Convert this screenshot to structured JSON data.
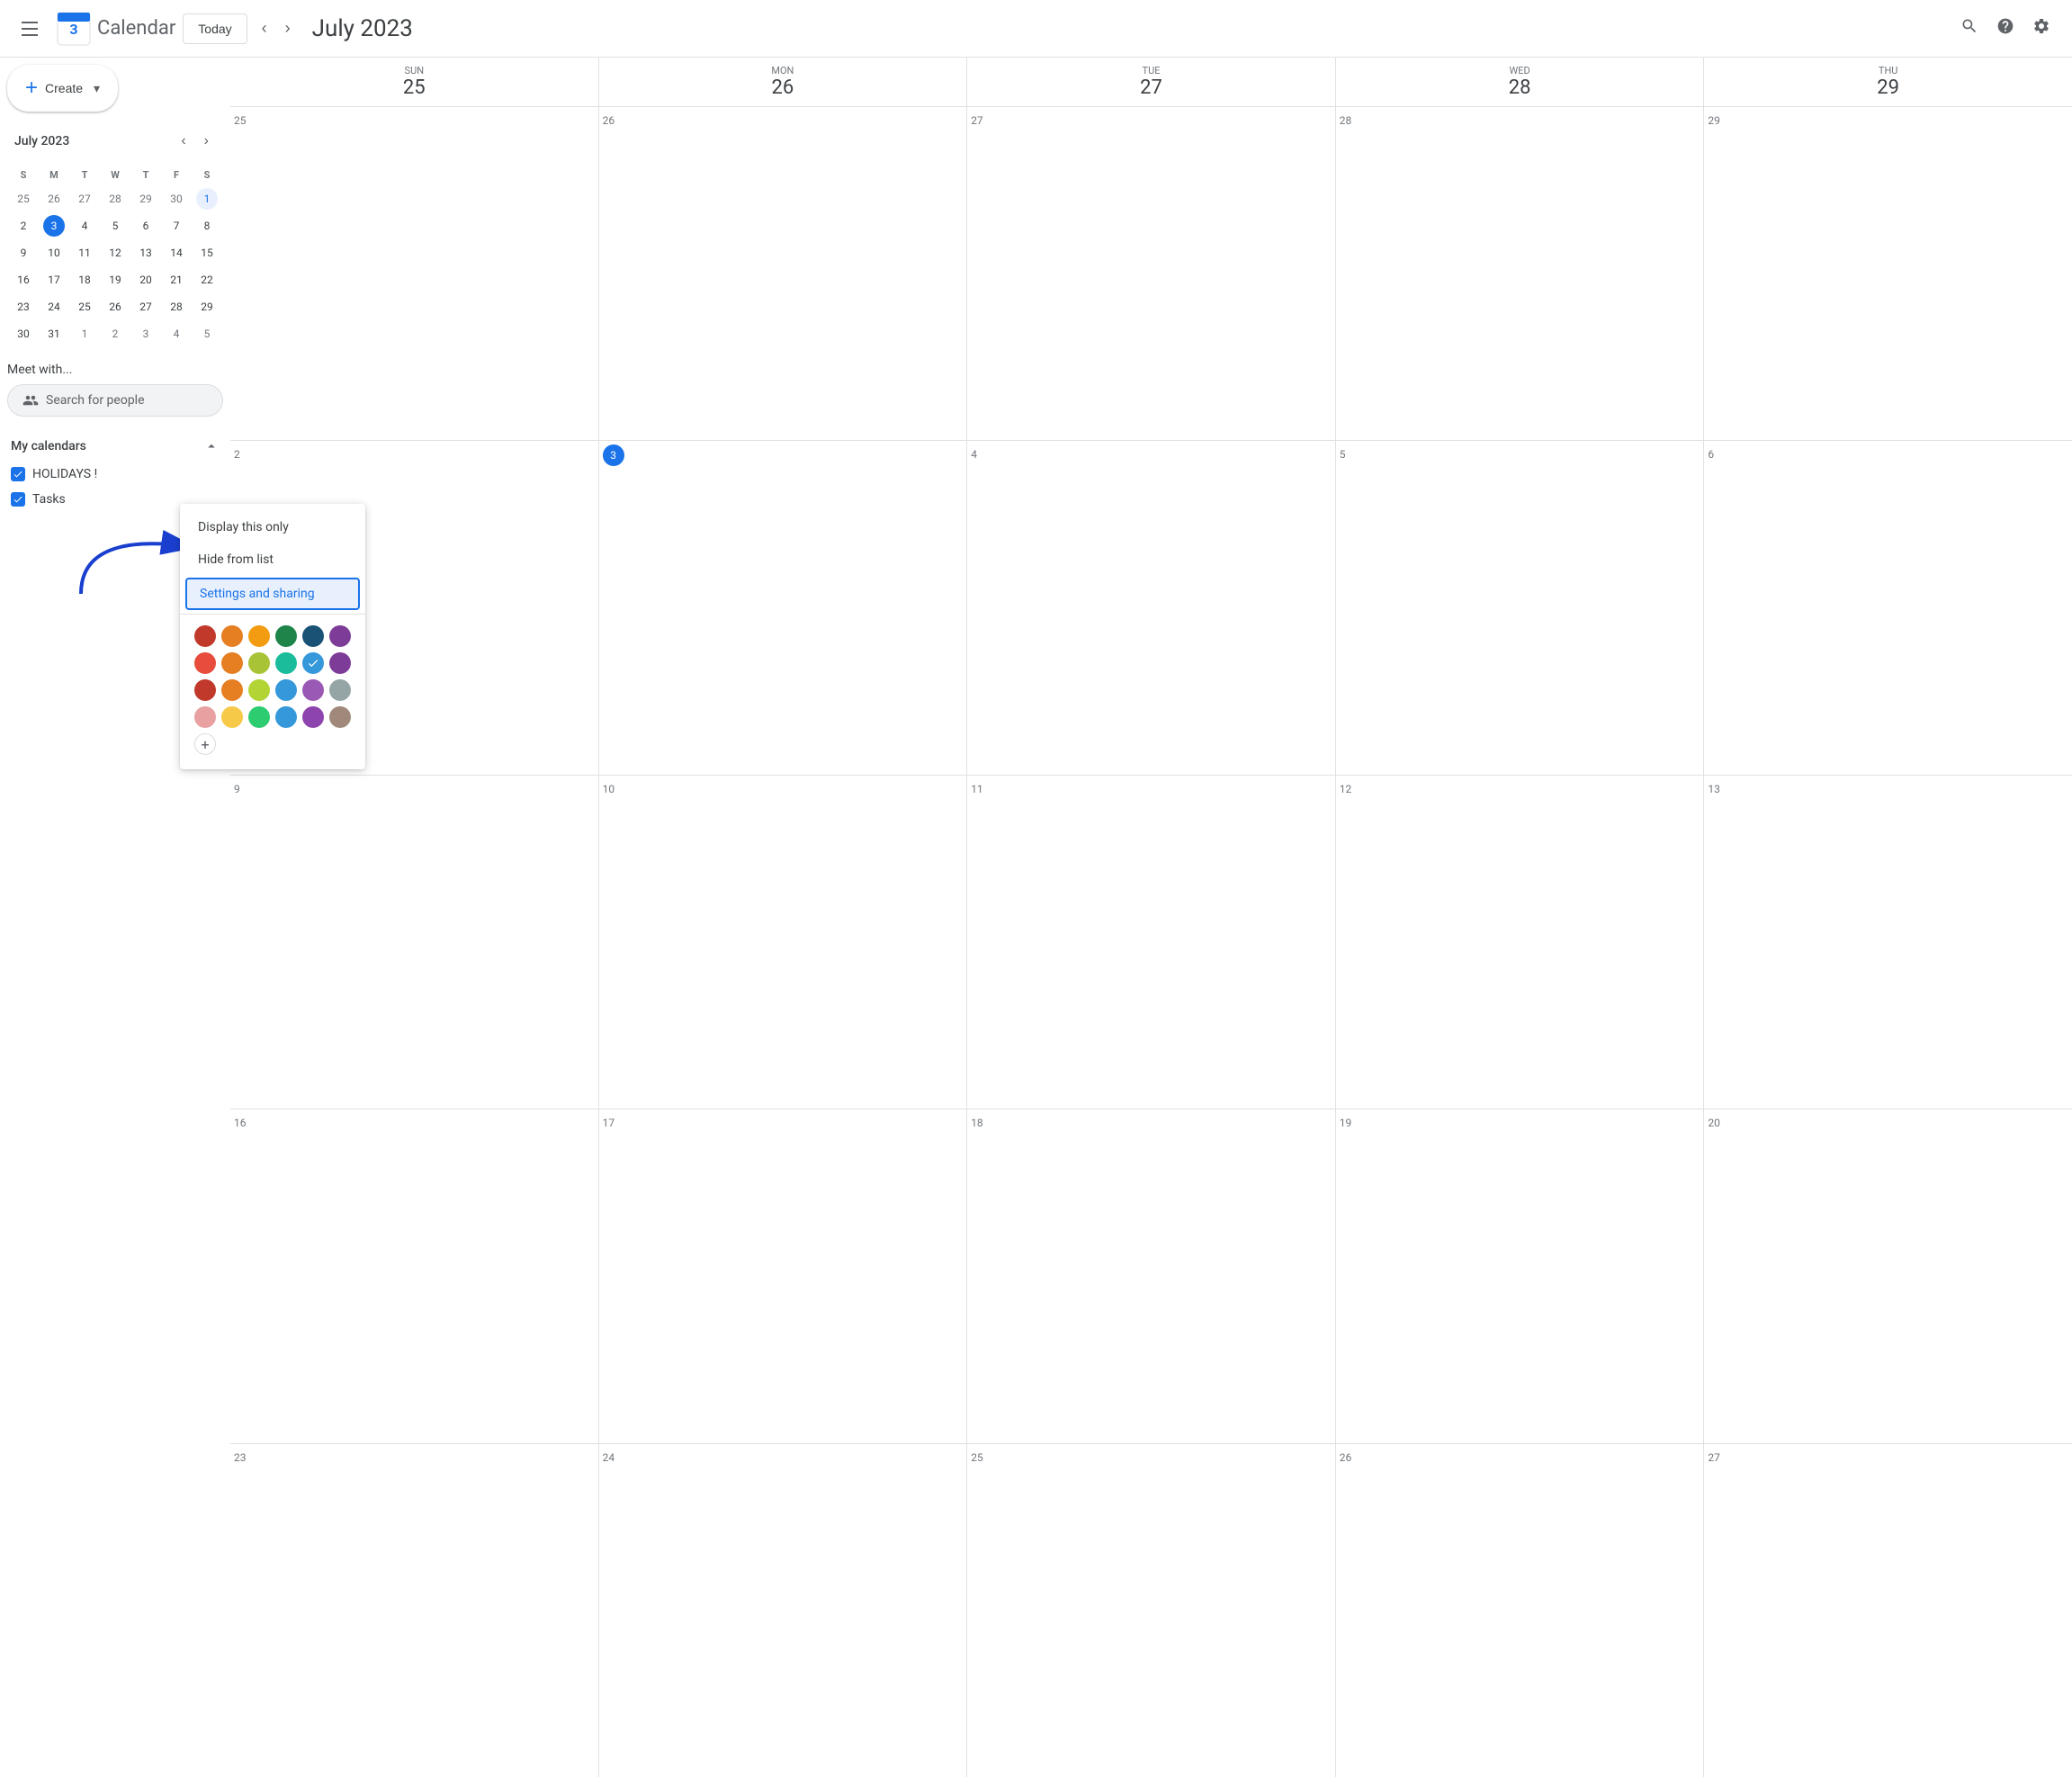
{
  "header": {
    "menu_icon": "☰",
    "logo_text": "Calendar",
    "today_label": "Today",
    "title": "July 2023",
    "search_title": "Search",
    "help_title": "Help",
    "settings_title": "Settings"
  },
  "sidebar": {
    "create_label": "Create",
    "mini_cal": {
      "title": "July 2023",
      "days_of_week": [
        "S",
        "M",
        "T",
        "W",
        "T",
        "F",
        "S"
      ],
      "weeks": [
        [
          {
            "num": "25",
            "other": true
          },
          {
            "num": "26",
            "other": true
          },
          {
            "num": "27",
            "other": true
          },
          {
            "num": "28",
            "other": true
          },
          {
            "num": "29",
            "other": true
          },
          {
            "num": "30",
            "other": true
          },
          {
            "num": "1",
            "first": true
          }
        ],
        [
          {
            "num": "2"
          },
          {
            "num": "3",
            "today": true
          },
          {
            "num": "4"
          },
          {
            "num": "5"
          },
          {
            "num": "6"
          },
          {
            "num": "7"
          },
          {
            "num": "8"
          }
        ],
        [
          {
            "num": "9"
          },
          {
            "num": "10"
          },
          {
            "num": "11"
          },
          {
            "num": "12"
          },
          {
            "num": "13"
          },
          {
            "num": "14"
          },
          {
            "num": "15"
          }
        ],
        [
          {
            "num": "16"
          },
          {
            "num": "17"
          },
          {
            "num": "18"
          },
          {
            "num": "19"
          },
          {
            "num": "20"
          },
          {
            "num": "21"
          },
          {
            "num": "22"
          }
        ],
        [
          {
            "num": "23"
          },
          {
            "num": "24"
          },
          {
            "num": "25"
          },
          {
            "num": "26"
          },
          {
            "num": "27"
          },
          {
            "num": "28"
          },
          {
            "num": "29"
          }
        ],
        [
          {
            "num": "30"
          },
          {
            "num": "31"
          },
          {
            "num": "1",
            "other": true
          },
          {
            "num": "2",
            "other": true
          },
          {
            "num": "3",
            "other": true
          },
          {
            "num": "4",
            "other": true
          },
          {
            "num": "5",
            "other": true
          }
        ]
      ]
    },
    "meet_with_title": "Meet with...",
    "search_people_placeholder": "Search for people",
    "my_calendars_title": "My calendars",
    "calendars": [
      {
        "label": "HOLIDAYS !",
        "color": "#1a73e8",
        "checked": true
      },
      {
        "label": "Tasks",
        "color": "#1a73e8",
        "checked": true
      }
    ]
  },
  "calendar": {
    "days": [
      {
        "day": "SUN",
        "num": "25"
      },
      {
        "day": "MON",
        "num": "26"
      },
      {
        "day": "TUE",
        "num": "27"
      },
      {
        "day": "WED",
        "num": "28"
      },
      {
        "day": "THU",
        "num": "29"
      }
    ],
    "weeks": [
      {
        "cells": [
          {
            "num": "25",
            "other": true
          },
          {
            "num": "26",
            "other": true
          },
          {
            "num": "27",
            "other": true
          },
          {
            "num": "28",
            "other": true
          },
          {
            "num": "29",
            "other": true
          }
        ]
      },
      {
        "cells": [
          {
            "num": "2"
          },
          {
            "num": "3",
            "today": true
          },
          {
            "num": "4"
          },
          {
            "num": "5"
          },
          {
            "num": "6"
          }
        ]
      },
      {
        "cells": [
          {
            "num": "9"
          },
          {
            "num": "10"
          },
          {
            "num": "11"
          },
          {
            "num": "12"
          },
          {
            "num": "13"
          }
        ]
      },
      {
        "cells": [
          {
            "num": "16"
          },
          {
            "num": "17"
          },
          {
            "num": "18"
          },
          {
            "num": "19"
          },
          {
            "num": "20"
          }
        ]
      },
      {
        "cells": [
          {
            "num": "23"
          },
          {
            "num": "24"
          },
          {
            "num": "25"
          },
          {
            "num": "26"
          },
          {
            "num": "27"
          }
        ]
      }
    ]
  },
  "dropdown": {
    "items": [
      {
        "label": "Display this only",
        "highlighted": false
      },
      {
        "label": "Hide from list",
        "highlighted": false
      },
      {
        "label": "Settings and sharing",
        "highlighted": true
      }
    ],
    "colors": [
      [
        "#c0392b",
        "#e67e22",
        "#f39c12",
        "#1e8449",
        "#1a5276",
        "#7d3c98"
      ],
      [
        "#e74c3c",
        "#e67e22",
        "#a8c436",
        "#1abc9c",
        "#3498db",
        "#7d3c98"
      ],
      [
        "#c0392b",
        "#e67e22",
        "#b2d435",
        "#3498db",
        "#9b59b6",
        "#95a5a6"
      ],
      [
        "#e8a0a0",
        "#f7c948",
        "#2ecc71",
        "#3498db",
        "#8e44ad",
        "#a0897a"
      ]
    ],
    "selected_color_row": 1,
    "selected_color_col": 4
  }
}
